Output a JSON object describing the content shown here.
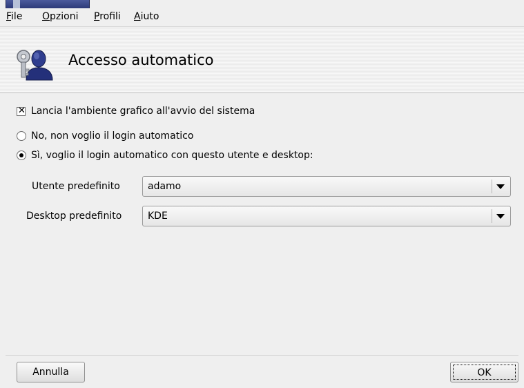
{
  "menu": {
    "file": {
      "accel": "F",
      "rest": "ile"
    },
    "opzioni": {
      "accel": "O",
      "rest": "pzioni"
    },
    "profili": {
      "accel": "P",
      "rest": "rofili"
    },
    "aiuto": {
      "accel": "A",
      "rest": "iuto"
    }
  },
  "header": {
    "title": "Accesso automatico",
    "icon": "user-key-icon"
  },
  "options": {
    "launch_gui": {
      "label": "Lancia l'ambiente grafico all'avvio del sistema",
      "checked": true
    },
    "no_autologin": {
      "label": "No, non voglio il login automatico",
      "selected": false
    },
    "yes_autologin": {
      "label": "Sì, voglio il login automatico con questo utente e desktop:",
      "selected": true
    }
  },
  "fields": {
    "user": {
      "label": "Utente predefinito",
      "value": "adamo"
    },
    "desktop": {
      "label": "Desktop predefinito",
      "value": "KDE"
    }
  },
  "buttons": {
    "cancel": "Annulla",
    "ok": "OK"
  },
  "icons": {
    "checkbox_mark": "✕"
  },
  "colors": {
    "window_bg": "#efefef",
    "icon_blue": "#2d3a78"
  }
}
